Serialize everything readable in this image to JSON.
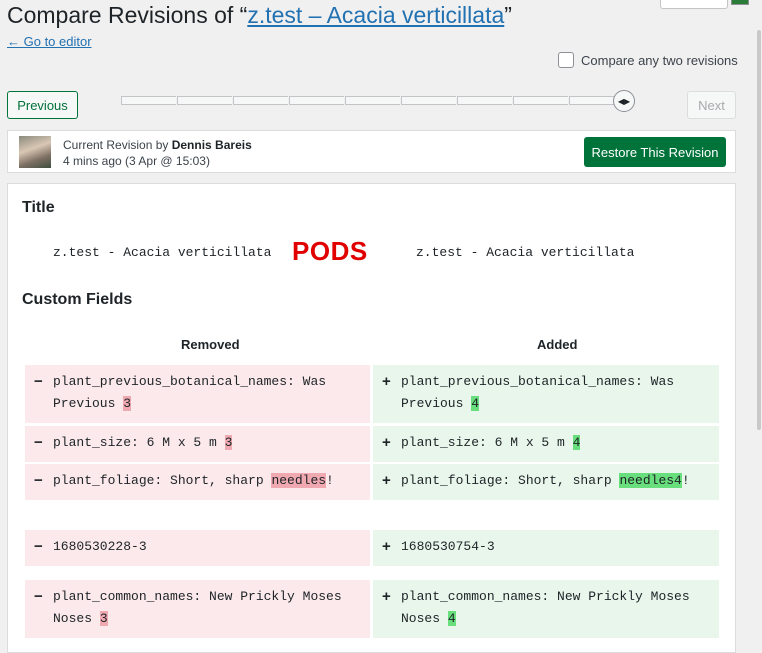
{
  "header": {
    "title_prefix": "Compare Revisions of “",
    "title_link": "z.test – Acacia verticillata",
    "title_suffix": "”",
    "back_link": "← Go to editor",
    "compare_two_label": "Compare any two revisions"
  },
  "nav": {
    "previous_label": "Previous",
    "next_label": "Next",
    "slider_ticks": 9
  },
  "revision": {
    "author_prefix": "Current Revision by ",
    "author_name": "Dennis Bareis",
    "time_ago": "4 mins ago",
    "date": "(3 Apr @ 15:03)",
    "restore_label": "Restore This Revision"
  },
  "diff": {
    "title_heading": "Title",
    "title_left": "z.test - Acacia verticillata",
    "title_right": "z.test - Acacia verticillata",
    "overlay": "PODS",
    "custom_heading": "Custom Fields",
    "removed_label": "Removed",
    "added_label": "Added",
    "rows": [
      {
        "del_line1": "plant_previous_botanical_names: Was",
        "del_line2": "Previous ",
        "del_hl": "3",
        "ins_line1": "plant_previous_botanical_names: Was",
        "ins_line2": "Previous ",
        "ins_hl": "4"
      },
      {
        "del_text": "plant_size: 6 M x 5 m ",
        "del_hl": "3",
        "ins_text": "plant_size: 6 M x 5 m ",
        "ins_hl": "4"
      },
      {
        "del_text": "plant_foliage: Short, sharp ",
        "del_hl": "needles",
        "del_tail": "!",
        "ins_text": "plant_foliage: Short, sharp ",
        "ins_hl": "needles4",
        "ins_tail": "!"
      },
      {
        "del_text": "1680530228-3",
        "ins_text": "1680530754-3"
      },
      {
        "del_line1": "plant_common_names: New Prickly Moses",
        "del_line2": "Noses ",
        "del_hl": "3",
        "ins_line1": "plant_common_names: New Prickly Moses",
        "ins_line2": "Noses ",
        "ins_hl": "4"
      }
    ],
    "minus_sign": "−",
    "plus_sign": "+"
  }
}
